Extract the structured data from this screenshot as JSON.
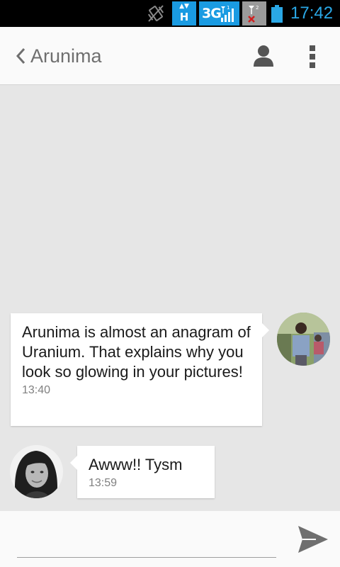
{
  "status_bar": {
    "network_h": "H",
    "network_3g": "3G",
    "time": "17:42"
  },
  "header": {
    "contact_name": "Arunima"
  },
  "messages": [
    {
      "text": "Arunima is almost an anagram of Uranium. That explains why you look so glowing in your pictures!",
      "time": "13:40"
    },
    {
      "text": "Awww!! Tysm",
      "time": "13:59"
    }
  ],
  "composer": {
    "placeholder": ""
  },
  "colors": {
    "accent": "#1a9be2",
    "time_text": "#2aa8e6",
    "background": "#e6e6e6"
  }
}
